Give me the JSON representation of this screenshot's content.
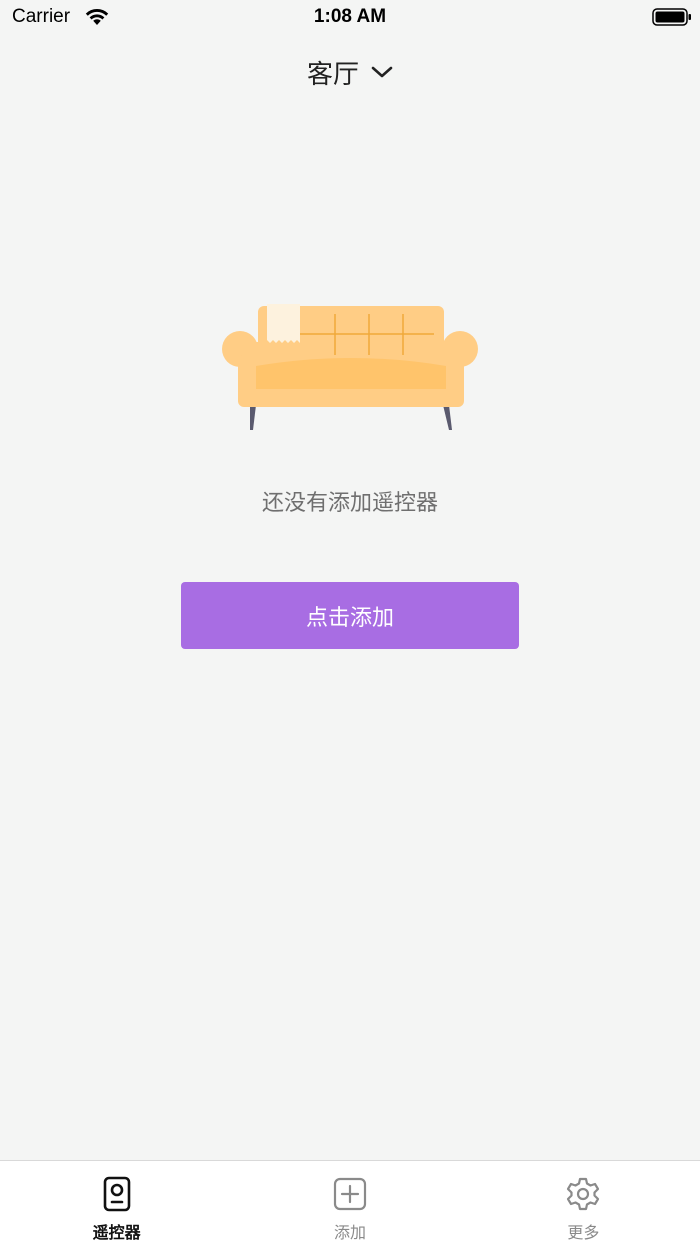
{
  "status_bar": {
    "carrier": "Carrier",
    "time": "1:08 AM"
  },
  "header": {
    "room": "客厅"
  },
  "empty_state": {
    "message": "还没有添加遥控器",
    "button_label": "点击添加"
  },
  "tab_bar": {
    "tabs": [
      {
        "label": "遥控器",
        "icon": "remote-icon",
        "active": true
      },
      {
        "label": "添加",
        "icon": "add-square-icon",
        "active": false
      },
      {
        "label": "更多",
        "icon": "gear-icon",
        "active": false
      }
    ]
  },
  "colors": {
    "accent": "#a86de3",
    "background": "#f4f5f4",
    "sofa": "#ffcd85",
    "sofa_seat": "#ffc46b",
    "sofa_legs": "#5a5a6e"
  }
}
